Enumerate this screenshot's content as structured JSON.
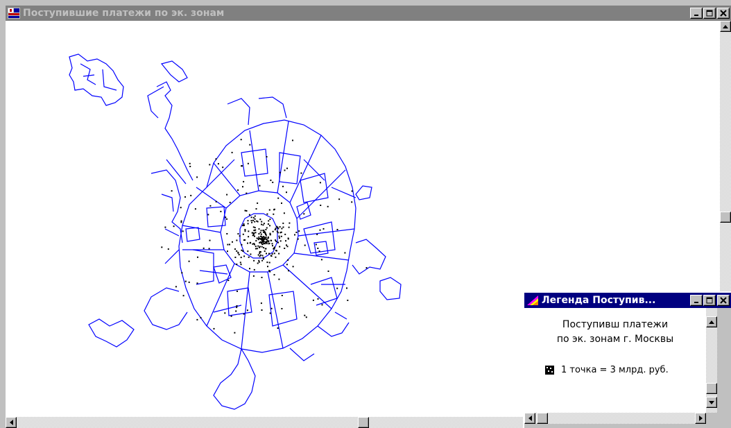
{
  "main_window": {
    "title": "Поступившие платежи по эк. зонам",
    "buttons": {
      "minimize": "minimize",
      "maximize": "maximize",
      "close": "close"
    }
  },
  "map": {
    "line_color": "#0000ff",
    "dot_color": "#000000"
  },
  "legend_window": {
    "title": "Легенда Поступив...",
    "heading_line1": "Поступивш платежи",
    "heading_line2": "по эк. зонам г. Москвы",
    "item_label": "1 точка = 3 млрд. руб."
  },
  "colors": {
    "active_title": "#000080",
    "inactive_title": "#808080",
    "face": "#c0c0c0"
  }
}
